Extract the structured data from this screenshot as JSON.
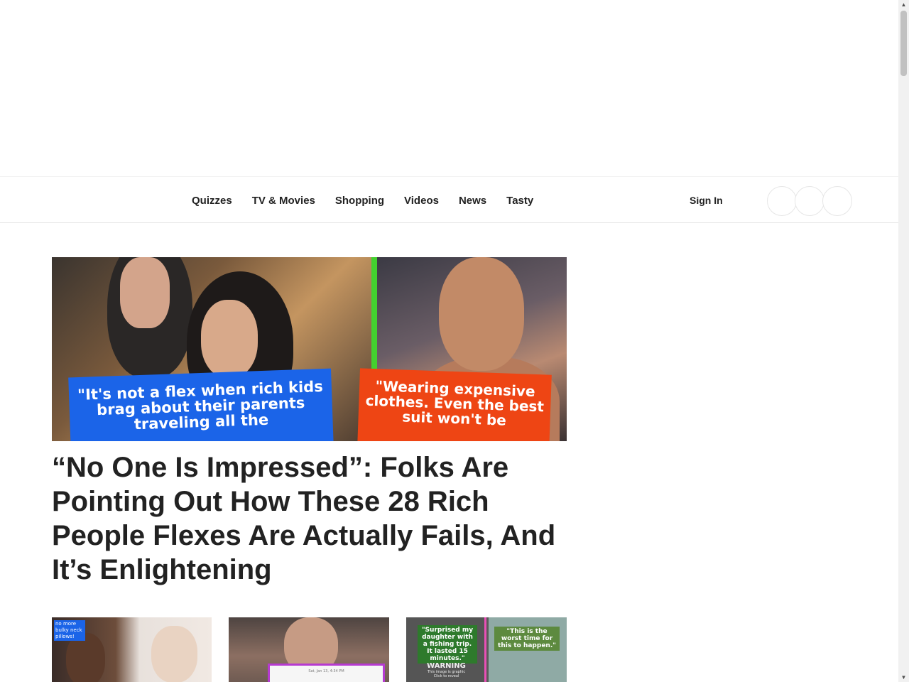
{
  "nav": {
    "links": [
      "Quizzes",
      "TV & Movies",
      "Shopping",
      "Videos",
      "News",
      "Tasty"
    ],
    "sign_in": "Sign In"
  },
  "hero": {
    "caption_left": "\"It's not a flex when rich kids brag about their parents traveling all the",
    "caption_right": "\"Wearing expensive clothes. Even the best suit won't be",
    "headline": "“No One Is Impressed”: Folks Are Pointing Out How These 28 Rich People Flexes Are Actually Fails, And It’s Enlightening"
  },
  "thumbnails": {
    "thumb1_tag": "no more bulky neck pillows!",
    "thumb2_text": "Sat, Jan 13, 4:34 PM",
    "thumb3_caption_left": "\"Surprised my daughter with a fishing trip. It lasted 15 minutes.\"",
    "thumb3_caption_right": "\"This is the worst time for this to happen.\"",
    "thumb3_warning_title": "WARNING",
    "thumb3_warning_text": "This image is graphic Click to reveal"
  },
  "colors": {
    "hero_divider": "#43d12f",
    "caption_blue": "#1b64e8",
    "caption_red": "#ee4514"
  }
}
